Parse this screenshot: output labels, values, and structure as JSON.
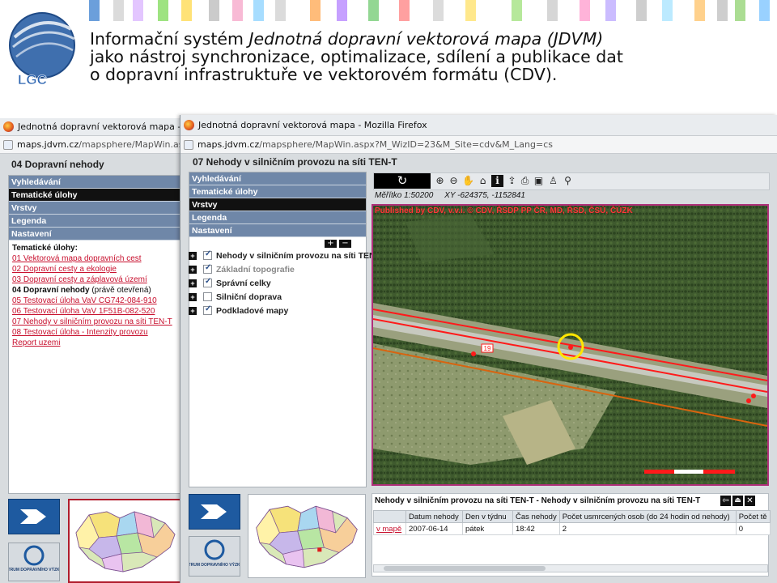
{
  "slide": {
    "title_part1": "Informační systém ",
    "title_italic": "Jednotná dopravní vektorová mapa (JDVM)",
    "title_line2": "jako nástroj synchronizace, optimalizace, sdílení a publikace dat",
    "title_line3": "o dopravní infrastruktuře ve vektorovém formátu (CDV).",
    "logo_text": "LGC"
  },
  "back_window": {
    "title": "Jednotná dopravní vektorová mapa - Mozil",
    "url_host": "maps.jdvm.cz",
    "url_path": "/mapsphere/MapWin.aspx?M",
    "page_header": "04 Dopravní nehody",
    "menu": [
      "Vyhledávání",
      "Tematické úlohy",
      "Vrstvy",
      "Legenda",
      "Nastavení"
    ],
    "tasks_heading": "Tematické úlohy:",
    "tasks": [
      "01 Vektorová mapa dopravních cest",
      "02 Dopravní cesty a ekologie",
      "03 Dopravní cesty a záplavová území"
    ],
    "current_task_bold": "04 Dopravní nehody",
    "current_task_suffix": " (právě otevřená)",
    "tasks_after": [
      "05 Testovací úloha VaV CG742-084-910",
      "06 Testovací úloha VaV 1F51B-082-520",
      "07 Nehody v silničním provozu na síti TEN-T",
      "08 Testovací úloha - Intenzity provozu",
      "Report uzemi"
    ],
    "cdv_label": "CENTRUM DOPRAVNÍHO VÝZKUMU"
  },
  "front_window": {
    "title": "Jednotná dopravní vektorová mapa - Mozilla Firefox",
    "url_host": "maps.jdvm.cz",
    "url_path": "/mapsphere/MapWin.aspx?M_WizID=23&M_Site=cdv&M_Lang=cs",
    "page_header": "07 Nehody v silničním provozu na síti TEN-T",
    "menu": [
      "Vyhledávání",
      "Tematické úlohy",
      "Vrstvy",
      "Legenda",
      "Nastavení"
    ],
    "active_menu_index": 2,
    "expand_all_label": "+",
    "collapse_all_label": "−",
    "layers": [
      {
        "label": "Nehody v silničním provozu na síti TEN",
        "checked": true,
        "dim": false
      },
      {
        "label": "Základní topografie",
        "checked": true,
        "dim": true
      },
      {
        "label": "Správní celky",
        "checked": true,
        "dim": false
      },
      {
        "label": "Silniční doprava",
        "checked": false,
        "dim": false
      },
      {
        "label": "Podkladové mapy",
        "checked": true,
        "dim": false
      }
    ],
    "scale_label": "Měřítko 1:50200",
    "coords_label": "XY -624375, -1152841",
    "attribution": "Published by CDV, v.v.i. © CDV, ŘSDP PP ČR, MD, ŘSD, ČSÚ, ČÚZK",
    "road_number": "19",
    "result_title": "Nehody v silničním provozu na síti TEN-T - Nehody v silničním provozu na síti TEN-T",
    "table": {
      "headers": [
        "",
        "Datum nehody",
        "Den v týdnu",
        "Čas nehody",
        "Počet usmrcených osob (do 24 hodin od nehody)",
        "Počet tě"
      ],
      "row": [
        "v mapě",
        "2007-06-14",
        "pátek",
        "18:42",
        "2",
        "0"
      ]
    },
    "cdv_label": "CENTRUM DOPRAVNÍHO VÝZKUMU"
  },
  "colors": {
    "menu_item": "#6f87a8",
    "menu_active": "#111111",
    "link": "#c8102e",
    "map_border": "#b0307a",
    "road_line": "#ff1a1a",
    "railway_line": "#d9640f",
    "accident_marker": "#ffe600"
  }
}
